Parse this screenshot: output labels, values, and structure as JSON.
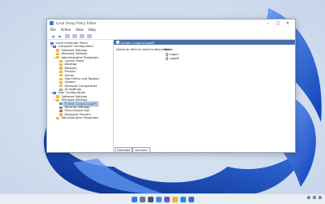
{
  "window": {
    "title": "Local Group Policy Editor",
    "controls": {
      "minimize": "–",
      "maximize": "□",
      "close": "✕"
    }
  },
  "menu": [
    "File",
    "Action",
    "View",
    "Help"
  ],
  "toolbar": [
    "back-arrow-icon",
    "forward-arrow-icon",
    "folder-up-icon",
    "show-hide-tree-icon",
    "properties-icon",
    "help-icon"
  ],
  "tree": [
    {
      "label": "Local Computer Policy",
      "icon": "computer",
      "indent": 0,
      "expander": ""
    },
    {
      "label": "Computer Configuration",
      "icon": "computer",
      "indent": 1,
      "expander": "▾"
    },
    {
      "label": "Software Settings",
      "icon": "folder",
      "indent": 2,
      "expander": "›"
    },
    {
      "label": "Windows Settings",
      "icon": "folder",
      "indent": 2,
      "expander": "›"
    },
    {
      "label": "Administrative Templates",
      "icon": "folder",
      "indent": 2,
      "expander": "▾"
    },
    {
      "label": "Control Panel",
      "icon": "folder",
      "indent": 3,
      "expander": "›"
    },
    {
      "label": "Desktop",
      "icon": "folder",
      "indent": 3,
      "expander": "›"
    },
    {
      "label": "Network",
      "icon": "folder",
      "indent": 3,
      "expander": "›"
    },
    {
      "label": "Printers",
      "icon": "folder",
      "indent": 3,
      "expander": ""
    },
    {
      "label": "Server",
      "icon": "folder",
      "indent": 3,
      "expander": ""
    },
    {
      "label": "Start Menu and Taskbar",
      "icon": "folder",
      "indent": 3,
      "expander": "›"
    },
    {
      "label": "System",
      "icon": "folder",
      "indent": 3,
      "expander": "›"
    },
    {
      "label": "Windows Components",
      "icon": "folder",
      "indent": 3,
      "expander": "›"
    },
    {
      "label": "All Settings",
      "icon": "doc",
      "indent": 3,
      "expander": ""
    },
    {
      "label": "User Configuration",
      "icon": "computer",
      "indent": 1,
      "expander": "▾"
    },
    {
      "label": "Software Settings",
      "icon": "folder",
      "indent": 2,
      "expander": "›"
    },
    {
      "label": "Windows Settings",
      "icon": "folder",
      "indent": 2,
      "expander": "▾"
    },
    {
      "label": "Scripts (Logon/Logoff)",
      "icon": "script",
      "indent": 3,
      "expander": "",
      "selected": true
    },
    {
      "label": "Security Settings",
      "icon": "shield",
      "indent": 3,
      "expander": "›"
    },
    {
      "label": "Policy-based QoS",
      "icon": "chart",
      "indent": 3,
      "expander": ""
    },
    {
      "label": "Deployed Printers",
      "icon": "folder",
      "indent": 3,
      "expander": ""
    },
    {
      "label": "Administrative Templates",
      "icon": "folder",
      "indent": 2,
      "expander": "›"
    }
  ],
  "details": {
    "header": "Scripts (Logon/Logoff)",
    "description": "Select an item to view its description.",
    "column_name": "Name",
    "items": [
      "Logon",
      "Logoff"
    ]
  },
  "tabs": [
    "Extended",
    "Standard"
  ],
  "active_tab": "Standard",
  "colors": {
    "accent": "#4a6fa5",
    "wallpaper_blue": "#1f5fd6",
    "wallpaper_bg": "#cfdcec"
  },
  "taskbar": {
    "icons": [
      "start-icon",
      "search-icon",
      "task-view-icon",
      "widgets-icon",
      "chat-icon",
      "file-explorer-icon",
      "edge-icon",
      "store-icon"
    ]
  }
}
